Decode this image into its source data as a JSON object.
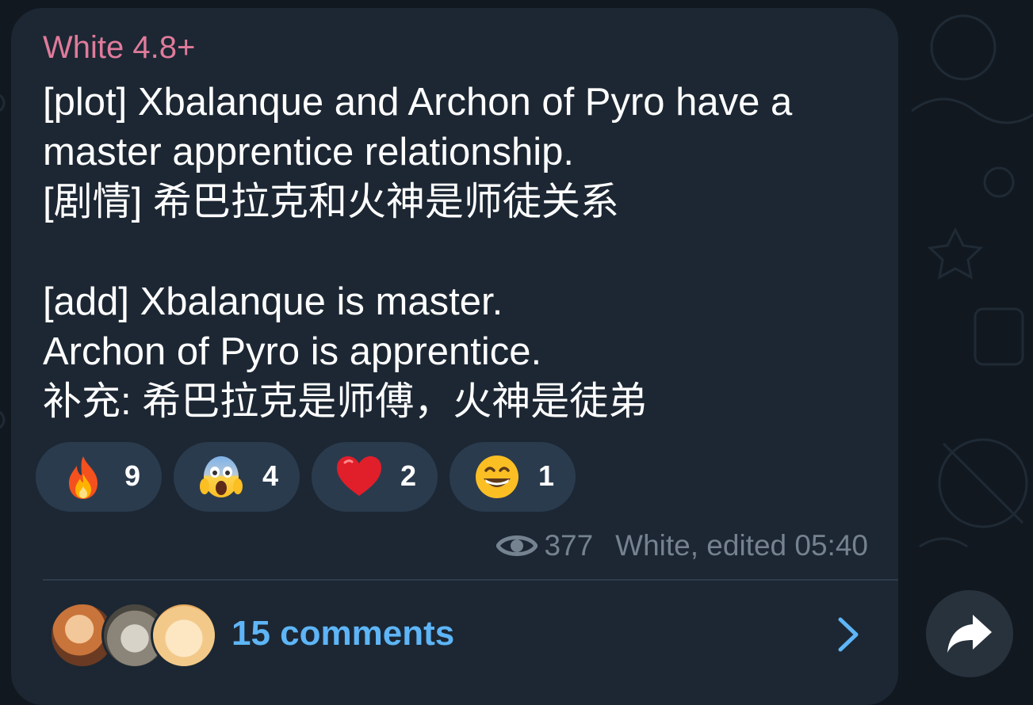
{
  "message": {
    "sender": "White 4.8+",
    "lines": [
      "[plot] Xbalanque and Archon of Pyro have a",
      "master apprentice relationship.",
      "[剧情] 希巴拉克和火神是师徒关系",
      "",
      "[add] Xbalanque is master.",
      "Archon of Pyro is apprentice.",
      "补充: 希巴拉克是师傅，火神是徒弟"
    ]
  },
  "reactions": [
    {
      "icon": "fire-emoji-icon",
      "count": "9"
    },
    {
      "icon": "screaming-face-emoji-icon",
      "count": "4"
    },
    {
      "icon": "red-heart-emoji-icon",
      "count": "2"
    },
    {
      "icon": "grinning-face-emoji-icon",
      "count": "1"
    }
  ],
  "meta": {
    "views": "377",
    "signature": "White, edited 05:40"
  },
  "comments": {
    "label": "15 comments"
  },
  "colors": {
    "background": "#111820",
    "bubble": "#1c2733",
    "sender": "#e07b9b",
    "accent": "#5eb5f7",
    "reaction_pill": "#2b3b4e",
    "meta_text": "#75828f"
  }
}
